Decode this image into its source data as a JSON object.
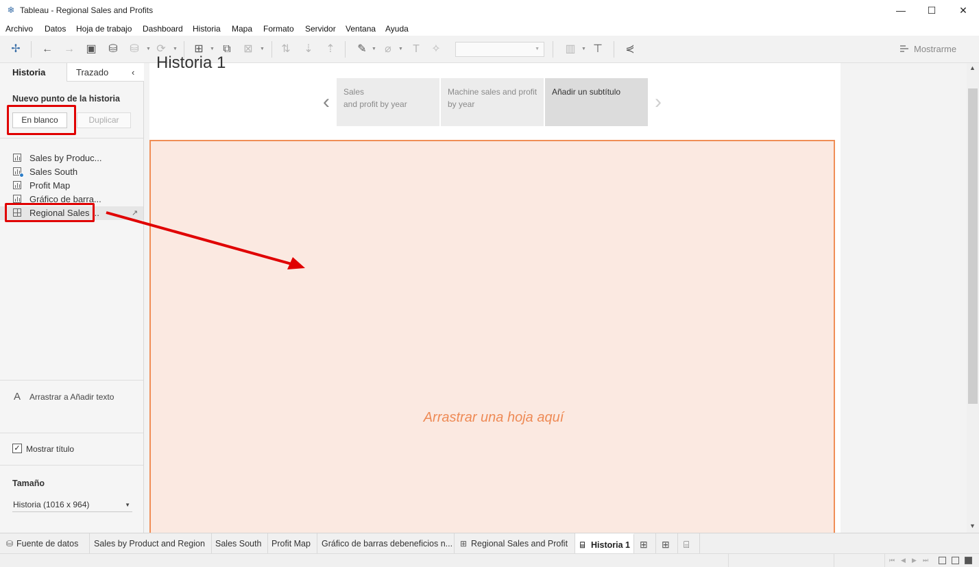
{
  "window": {
    "title": "Tableau - Regional Sales and Profits",
    "app_icon": "tableau-logo-icon",
    "controls": [
      "minimize-icon",
      "maximize-icon",
      "close-icon"
    ]
  },
  "menu": [
    "Archivo",
    "Datos",
    "Hoja de trabajo",
    "Dashboard",
    "Historia",
    "Mapa",
    "Formato",
    "Servidor",
    "Ventana",
    "Ayuda"
  ],
  "toolbar": {
    "show_me": "Mostrarme",
    "icons": [
      "tableau-start-icon",
      "undo-icon",
      "redo-icon",
      "save-icon",
      "new-data-source-icon",
      "pause-updates-icon",
      "refresh-icon",
      "new-worksheet-icon",
      "duplicate-sheet-icon",
      "clear-sheet-icon",
      "swap-axes-icon",
      "sort-ascending-icon",
      "sort-descending-icon",
      "highlight-icon",
      "group-members-icon",
      "show-labels-icon",
      "fix-axes-icon",
      "cards-icon",
      "presentation-icon",
      "share-icon"
    ]
  },
  "left_panel": {
    "tabs": {
      "story": "Historia",
      "layout": "Trazado"
    },
    "new_point_title": "Nuevo punto de la historia",
    "buttons": {
      "blank": "En blanco",
      "duplicate": "Duplicar"
    },
    "sheets": [
      {
        "label": "Sales by Produc...",
        "icon": "bar-chart-icon"
      },
      {
        "label": "Sales South",
        "icon": "bar-chart-icon"
      },
      {
        "label": "Profit Map",
        "icon": "bar-chart-icon"
      },
      {
        "label": "Gráfico de barra...",
        "icon": "bar-chart-icon"
      },
      {
        "label": "Regional Sales ...",
        "icon": "dashboard-grid-icon"
      }
    ],
    "text_object": {
      "icon_glyph": "A",
      "label": "Arrastrar a Añadir texto"
    },
    "show_title": {
      "label": "Mostrar título",
      "checked": true
    },
    "size": {
      "title": "Tamaño",
      "value": "Historia (1016 x 964)"
    }
  },
  "story": {
    "title": "Historia 1",
    "points": [
      {
        "text": "Sales\nand profit by year"
      },
      {
        "text": "Machine sales and profit by year"
      },
      {
        "text": "Añadir un subtítulo",
        "active": true
      }
    ],
    "drop_hint": "Arrastrar una hoja aquí"
  },
  "bottom_tabs": [
    {
      "label": "Fuente de datos",
      "icon": "datasource-icon"
    },
    {
      "label": "Sales by Product and Region"
    },
    {
      "label": "Sales South"
    },
    {
      "label": "Profit Map"
    },
    {
      "label": "Gráfico de barras debeneficios n..."
    },
    {
      "label": "Regional Sales and Profit",
      "icon": "dashboard-grid-icon"
    },
    {
      "label": "Historia 1",
      "icon": "story-book-icon",
      "active": true
    }
  ],
  "colors": {
    "annotation_red": "#e00000",
    "drop_zone_fill": "#fbe9e1",
    "drop_zone_border": "#f08d55",
    "drop_hint_text": "#ee8a55"
  }
}
